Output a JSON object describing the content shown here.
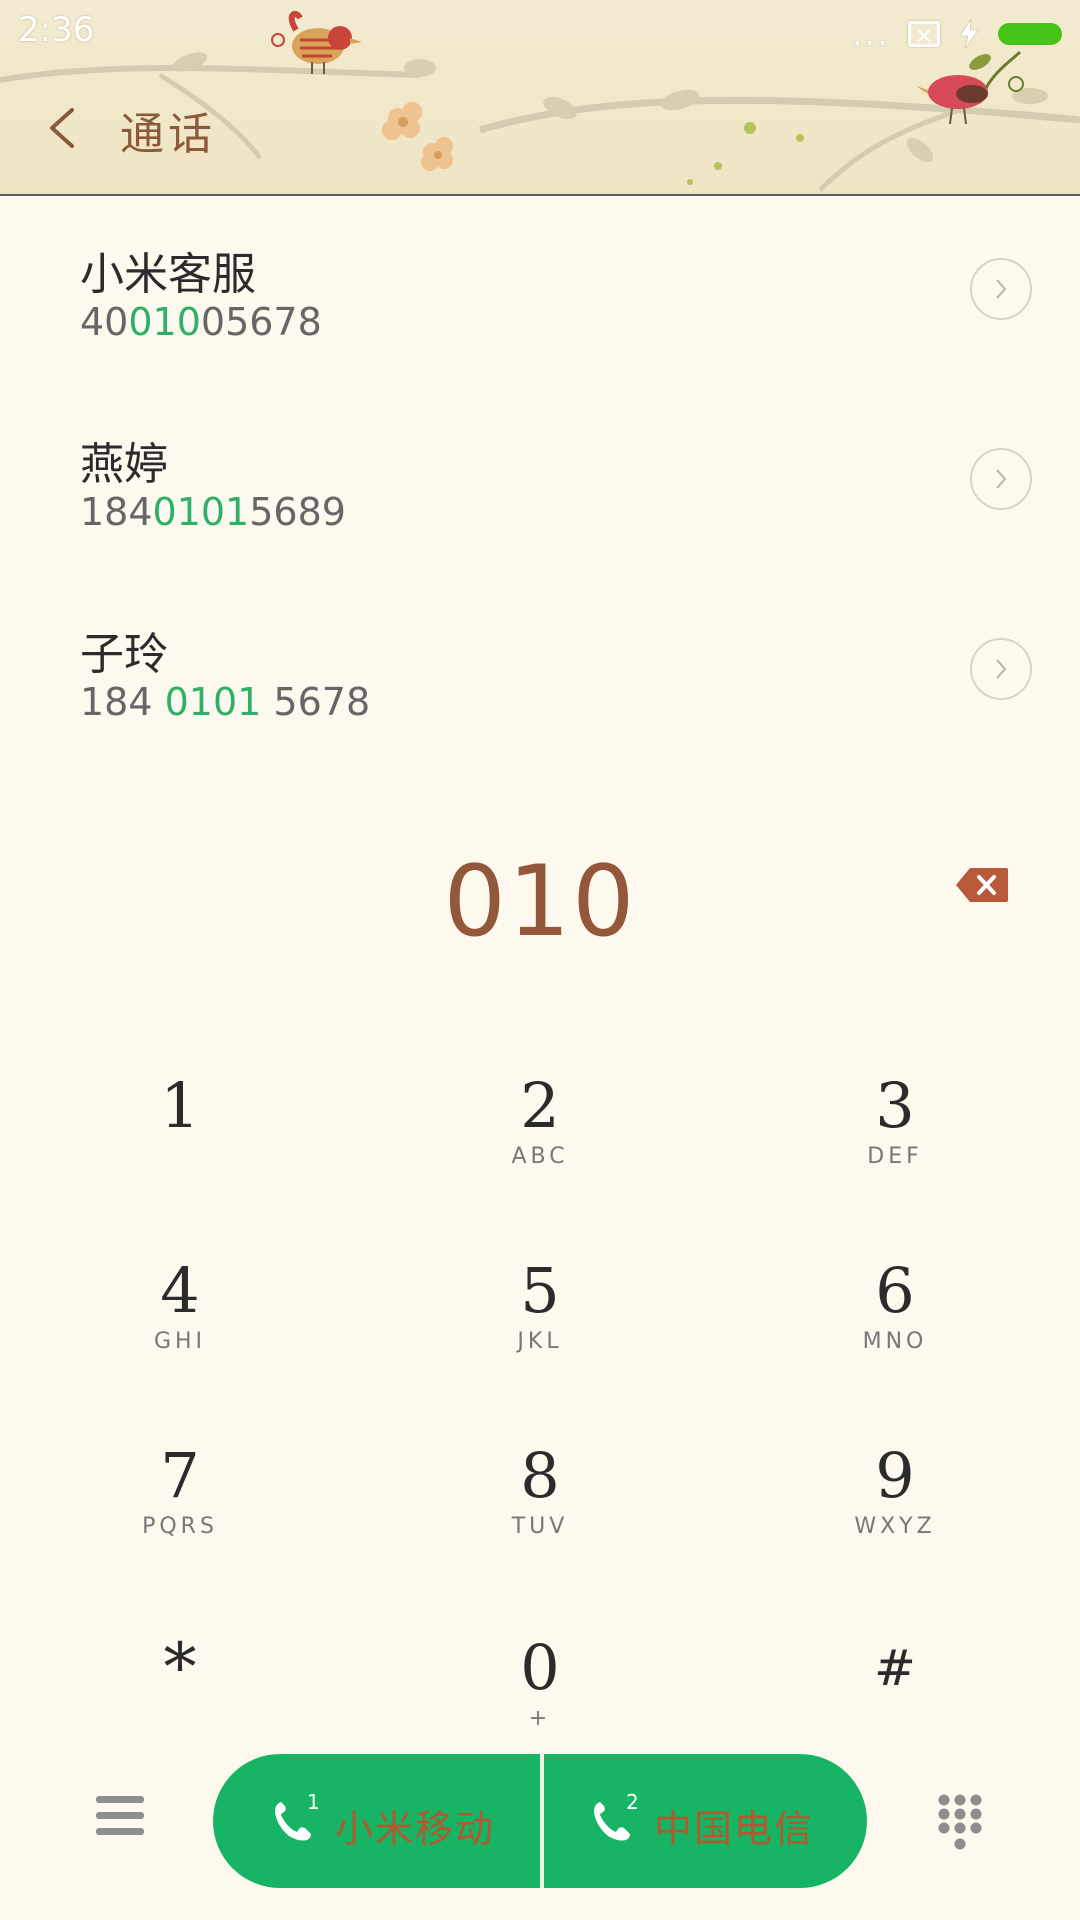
{
  "status_bar": {
    "time": "2:36",
    "dots": "..."
  },
  "header": {
    "title": "通话"
  },
  "contacts": [
    {
      "name": "小米客服",
      "number_parts": [
        "40",
        "010",
        "05678"
      ]
    },
    {
      "name": "燕婷",
      "number_parts": [
        "184",
        "0101",
        "5689"
      ]
    },
    {
      "name": "子玲",
      "number_parts": [
        "184 ",
        "0101",
        " 5678"
      ]
    }
  ],
  "dial": {
    "input": "010"
  },
  "keypad": [
    {
      "digit": "1",
      "letters": ""
    },
    {
      "digit": "2",
      "letters": "ABC"
    },
    {
      "digit": "3",
      "letters": "DEF"
    },
    {
      "digit": "4",
      "letters": "GHI"
    },
    {
      "digit": "5",
      "letters": "JKL"
    },
    {
      "digit": "6",
      "letters": "MNO"
    },
    {
      "digit": "7",
      "letters": "PQRS"
    },
    {
      "digit": "8",
      "letters": "TUV"
    },
    {
      "digit": "9",
      "letters": "WXYZ"
    },
    {
      "digit": "*",
      "letters": ""
    },
    {
      "digit": "0",
      "letters": "+"
    },
    {
      "digit": "#",
      "letters": ""
    }
  ],
  "call_buttons": [
    {
      "sim": "1",
      "label": "小米移动"
    },
    {
      "sim": "2",
      "label": "中国电信"
    }
  ],
  "colors": {
    "accent_green": "#16b464",
    "highlight_green": "#2fb066",
    "brown": "#93573a",
    "background": "#fdf9ee"
  },
  "icons": {
    "back": "chevron-left-icon",
    "detail": "chevron-right-icon",
    "backspace": "backspace-icon",
    "menu": "hamburger-menu-icon",
    "call": "phone-icon",
    "dialpad": "dialpad-icon"
  }
}
